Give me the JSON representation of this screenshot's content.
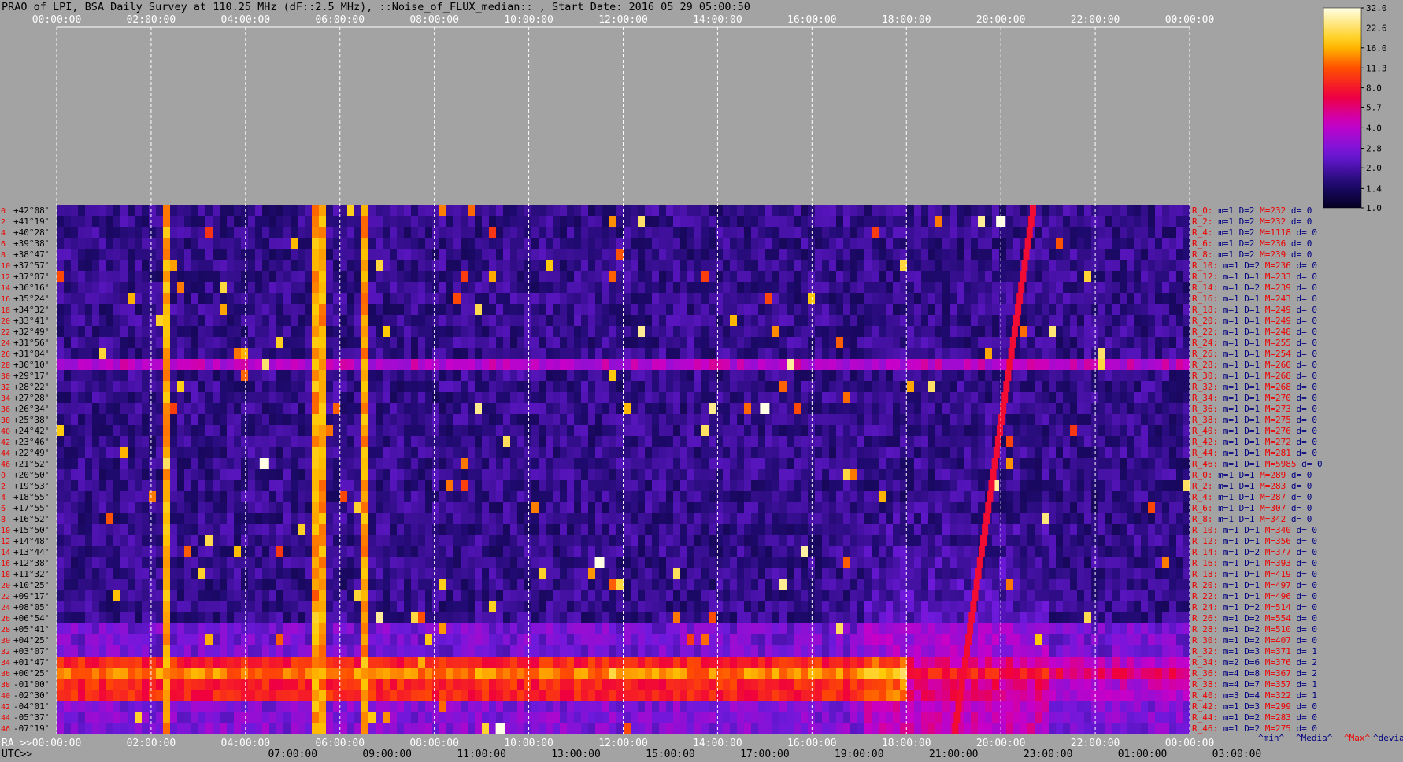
{
  "title": "PRAO of LPI, BSA Daily Survey at 110.25 MHz (dF::2.5 MHz), ::Noise_of_FLUX_median:: , Start Date: 2016 05 29 05:00:50",
  "colors": {
    "background": "#a3a3a3",
    "label_red": "#ee0000",
    "label_blue": "#000080",
    "tick_text": "#ffffff",
    "row_label_text": "#000000"
  },
  "axis_labels": {
    "ra_prefix": "RA >>",
    "utc_prefix": "UTC>>"
  },
  "colorbar_ticks": [
    "32.0",
    "22.6",
    "16.0",
    "11.3",
    "8.0",
    "5.7",
    "4.0",
    "2.8",
    "2.0",
    "1.4",
    "1.0"
  ],
  "stat_headers": [
    "^min^",
    "^Media^",
    "^Max^",
    "^devia^"
  ],
  "chart_data": {
    "type": "heatmap",
    "title": "PRAO of LPI, BSA Daily Survey at 110.25 MHz (dF::2.5 MHz), ::Noise_of_FLUX_median:: , Start Date: 2016 05 29 05:00:50",
    "ra_ticks": [
      "00:00:00",
      "02:00:00",
      "04:00:00",
      "06:00:00",
      "08:00:00",
      "10:00:00",
      "12:00:00",
      "14:00:00",
      "16:00:00",
      "18:00:00",
      "20:00:00",
      "22:00:00",
      "00:00:00"
    ],
    "utc_ticks": [
      "07:00:00",
      "09:00:00",
      "11:00:00",
      "13:00:00",
      "15:00:00",
      "17:00:00",
      "19:00:00",
      "21:00:00",
      "23:00:00",
      "01:00:00",
      "03:00:00"
    ],
    "ra_range_hours": [
      0,
      24
    ],
    "beam_index_labels": [
      "0",
      "2",
      "4",
      "6",
      "8",
      "10",
      "12",
      "14",
      "16",
      "18",
      "20",
      "22",
      "24",
      "26",
      "28",
      "30",
      "32",
      "34",
      "36",
      "38",
      "40",
      "42",
      "44",
      "46",
      "0",
      "2",
      "4",
      "6",
      "8",
      "10",
      "12",
      "14",
      "16",
      "18",
      "20",
      "22",
      "24",
      "26",
      "28",
      "30",
      "32",
      "34",
      "36",
      "38",
      "40",
      "42",
      "44",
      "46"
    ],
    "declinations": [
      "+42°08'",
      "+41°19'",
      "+40°28'",
      "+39°38'",
      "+38°47'",
      "+37°57'",
      "+37°07'",
      "+36°16'",
      "+35°24'",
      "+34°32'",
      "+33°41'",
      "+32°49'",
      "+31°56'",
      "+31°04'",
      "+30°10'",
      "+29°17'",
      "+28°22'",
      "+27°28'",
      "+26°34'",
      "+25°38'",
      "+24°42'",
      "+23°46'",
      "+22°49'",
      "+21°52'",
      "+20°50'",
      "+19°53'",
      "+18°55'",
      "+17°55'",
      "+16°52'",
      "+15°50'",
      "+14°48'",
      "+13°44'",
      "+12°38'",
      "+11°32'",
      "+10°25'",
      "+09°17'",
      "+08°05'",
      "+06°54'",
      "+05°41'",
      "+04°25'",
      "+03°07'",
      "+01°47'",
      "+00°25'",
      "-01°00'",
      "-02°30'",
      "-04°01'",
      "-05°37'",
      "-07°19'"
    ],
    "colorscale": {
      "min": 1.0,
      "max": 32.0,
      "scale": "log",
      "ticks": [
        32.0,
        22.6,
        16.0,
        11.3,
        8.0,
        5.7,
        4.0,
        2.8,
        2.0,
        1.4,
        1.0
      ]
    },
    "rows": [
      {
        "beam": "R_0:",
        "m": 1,
        "D": 2,
        "M": 232,
        "d": 0
      },
      {
        "beam": "R_2:",
        "m": 1,
        "D": 2,
        "M": 232,
        "d": 0
      },
      {
        "beam": "R_4:",
        "m": 1,
        "D": 2,
        "M": 1118,
        "d": 0
      },
      {
        "beam": "R_6:",
        "m": 1,
        "D": 2,
        "M": 236,
        "d": 0
      },
      {
        "beam": "R_8:",
        "m": 1,
        "D": 2,
        "M": 239,
        "d": 0
      },
      {
        "beam": "R_10:",
        "m": 1,
        "D": 2,
        "M": 236,
        "d": 0
      },
      {
        "beam": "R_12:",
        "m": 1,
        "D": 1,
        "M": 233,
        "d": 0
      },
      {
        "beam": "R_14:",
        "m": 1,
        "D": 2,
        "M": 239,
        "d": 0
      },
      {
        "beam": "R_16:",
        "m": 1,
        "D": 1,
        "M": 243,
        "d": 0
      },
      {
        "beam": "R_18:",
        "m": 1,
        "D": 1,
        "M": 249,
        "d": 0
      },
      {
        "beam": "R_20:",
        "m": 1,
        "D": 1,
        "M": 249,
        "d": 0
      },
      {
        "beam": "R_22:",
        "m": 1,
        "D": 1,
        "M": 248,
        "d": 0
      },
      {
        "beam": "R_24:",
        "m": 1,
        "D": 1,
        "M": 255,
        "d": 0
      },
      {
        "beam": "R_26:",
        "m": 1,
        "D": 1,
        "M": 254,
        "d": 0
      },
      {
        "beam": "R_28:",
        "m": 1,
        "D": 1,
        "M": 260,
        "d": 0
      },
      {
        "beam": "R_30:",
        "m": 1,
        "D": 1,
        "M": 268,
        "d": 0
      },
      {
        "beam": "R_32:",
        "m": 1,
        "D": 1,
        "M": 268,
        "d": 0
      },
      {
        "beam": "R_34:",
        "m": 1,
        "D": 1,
        "M": 270,
        "d": 0
      },
      {
        "beam": "R_36:",
        "m": 1,
        "D": 1,
        "M": 273,
        "d": 0
      },
      {
        "beam": "R_38:",
        "m": 1,
        "D": 1,
        "M": 275,
        "d": 0
      },
      {
        "beam": "R_40:",
        "m": 1,
        "D": 1,
        "M": 276,
        "d": 0
      },
      {
        "beam": "R_42:",
        "m": 1,
        "D": 1,
        "M": 272,
        "d": 0
      },
      {
        "beam": "R_44:",
        "m": 1,
        "D": 1,
        "M": 281,
        "d": 0
      },
      {
        "beam": "R_46:",
        "m": 1,
        "D": 1,
        "M": 5985,
        "d": 0
      },
      {
        "beam": "R_0:",
        "m": 1,
        "D": 1,
        "M": 289,
        "d": 0
      },
      {
        "beam": "R_2:",
        "m": 1,
        "D": 1,
        "M": 283,
        "d": 0
      },
      {
        "beam": "R_4:",
        "m": 1,
        "D": 1,
        "M": 287,
        "d": 0
      },
      {
        "beam": "R_6:",
        "m": 1,
        "D": 1,
        "M": 307,
        "d": 0
      },
      {
        "beam": "R_8:",
        "m": 1,
        "D": 1,
        "M": 342,
        "d": 0
      },
      {
        "beam": "R_10:",
        "m": 1,
        "D": 1,
        "M": 340,
        "d": 0
      },
      {
        "beam": "R_12:",
        "m": 1,
        "D": 1,
        "M": 356,
        "d": 0
      },
      {
        "beam": "R_14:",
        "m": 1,
        "D": 2,
        "M": 377,
        "d": 0
      },
      {
        "beam": "R_16:",
        "m": 1,
        "D": 1,
        "M": 393,
        "d": 0
      },
      {
        "beam": "R_18:",
        "m": 1,
        "D": 1,
        "M": 419,
        "d": 0
      },
      {
        "beam": "R_20:",
        "m": 1,
        "D": 1,
        "M": 497,
        "d": 0
      },
      {
        "beam": "R_22:",
        "m": 1,
        "D": 1,
        "M": 496,
        "d": 0
      },
      {
        "beam": "R_24:",
        "m": 1,
        "D": 2,
        "M": 514,
        "d": 0
      },
      {
        "beam": "R_26:",
        "m": 1,
        "D": 2,
        "M": 554,
        "d": 0
      },
      {
        "beam": "R_28:",
        "m": 1,
        "D": 2,
        "M": 510,
        "d": 0
      },
      {
        "beam": "R_30:",
        "m": 1,
        "D": 2,
        "M": 407,
        "d": 0
      },
      {
        "beam": "R_32:",
        "m": 1,
        "D": 3,
        "M": 371,
        "d": 1
      },
      {
        "beam": "R_34:",
        "m": 2,
        "D": 6,
        "M": 376,
        "d": 2
      },
      {
        "beam": "R_36:",
        "m": 4,
        "D": 8,
        "M": 367,
        "d": 2
      },
      {
        "beam": "R_38:",
        "m": 4,
        "D": 7,
        "M": 357,
        "d": 1
      },
      {
        "beam": "R_40:",
        "m": 3,
        "D": 4,
        "M": 322,
        "d": 1
      },
      {
        "beam": "R_42:",
        "m": 1,
        "D": 3,
        "M": 299,
        "d": 0
      },
      {
        "beam": "R_44:",
        "m": 1,
        "D": 2,
        "M": 283,
        "d": 0
      },
      {
        "beam": "R_46:",
        "m": 1,
        "D": 2,
        "M": 275,
        "d": 0
      }
    ]
  }
}
